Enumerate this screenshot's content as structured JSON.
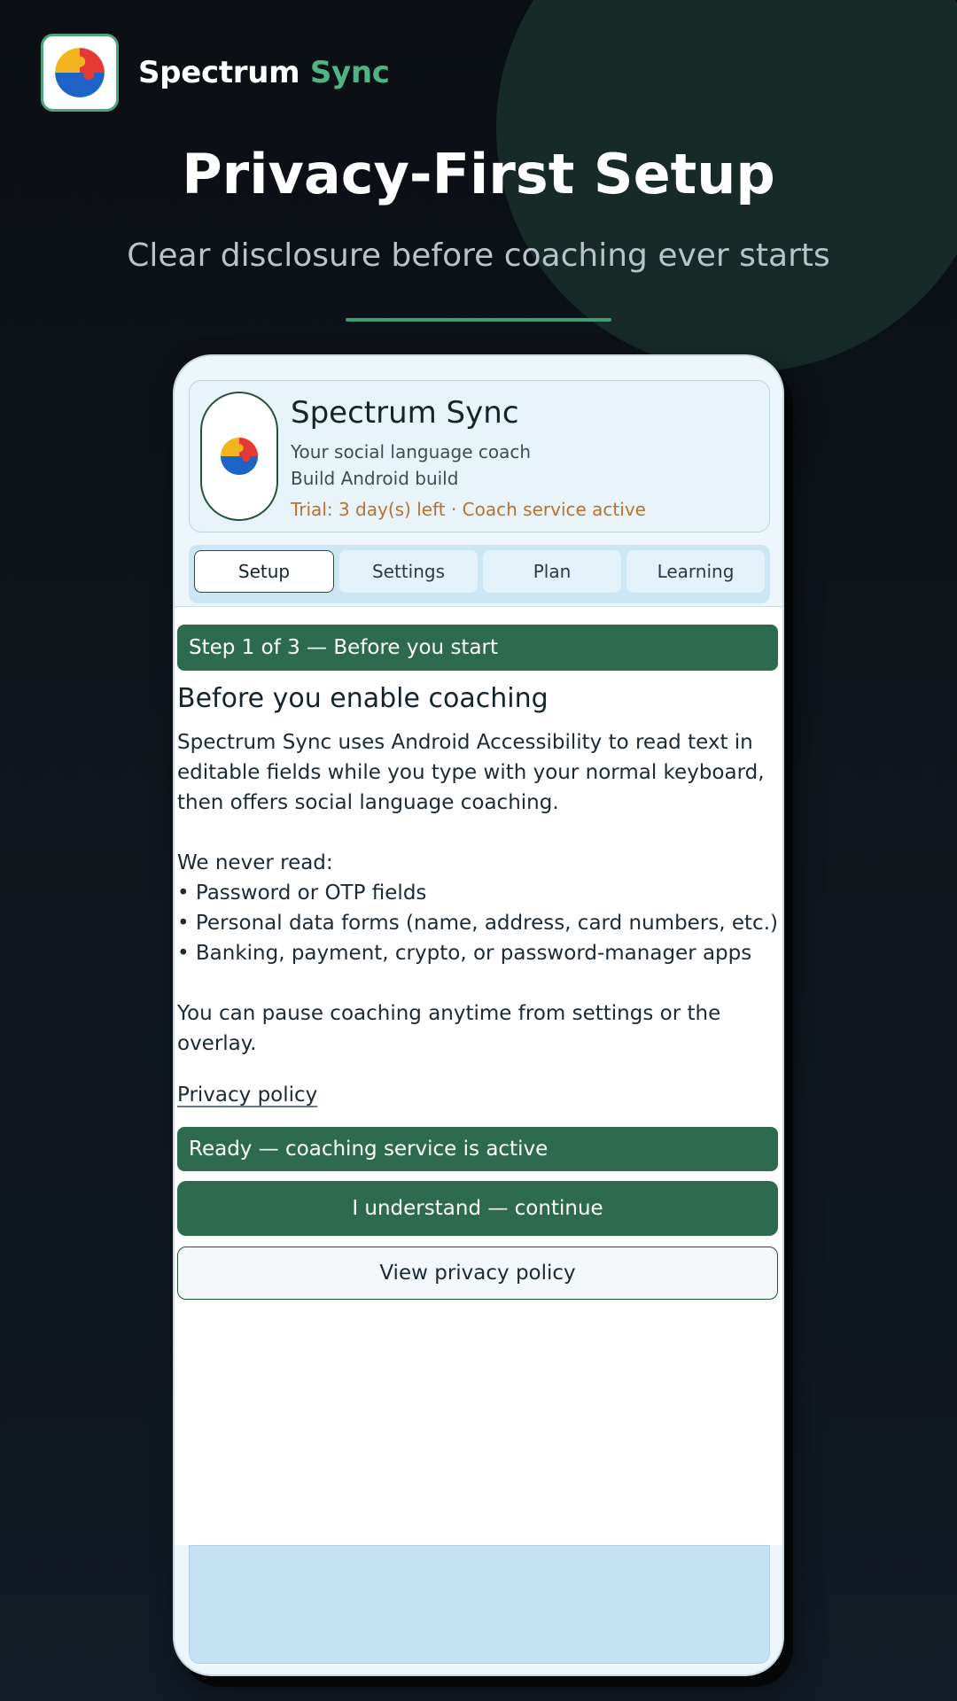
{
  "brand": {
    "name_main": "Spectrum",
    "name_accent": "Sync",
    "logo_icon": "puzzle-logo-icon",
    "accent_color": "#4fb383"
  },
  "hero": {
    "title": "Privacy-First Setup",
    "subtitle": "Clear disclosure before coaching ever starts"
  },
  "app": {
    "name": "Spectrum Sync",
    "tagline": "Your social language coach",
    "build": "Build Android build",
    "trial": "Trial: 3 day(s) left · Coach service active",
    "trial_color": "#b8722d"
  },
  "tabs": [
    {
      "label": "Setup",
      "active": true
    },
    {
      "label": "Settings",
      "active": false
    },
    {
      "label": "Plan",
      "active": false
    },
    {
      "label": "Learning",
      "active": false
    }
  ],
  "step": {
    "banner": "Step 1 of 3 — Before you start",
    "title": "Before you enable coaching",
    "intro": "Spectrum Sync uses Android Accessibility to read text in editable fields while you type with your normal keyboard, then offers social language coaching.",
    "never_read_heading": "We never read:",
    "never_read_items": [
      "• Password or OTP fields",
      "• Personal data forms (name, address, card numbers, etc.)",
      "• Banking, payment, crypto, or password-manager apps"
    ],
    "pause_note": "You can pause coaching anytime from settings or the overlay.",
    "privacy_link": "Privacy policy",
    "status": "Ready — coaching service is active",
    "primary_button": "I understand — continue",
    "secondary_button": "View privacy policy",
    "primary_color": "#2e6b4e"
  }
}
